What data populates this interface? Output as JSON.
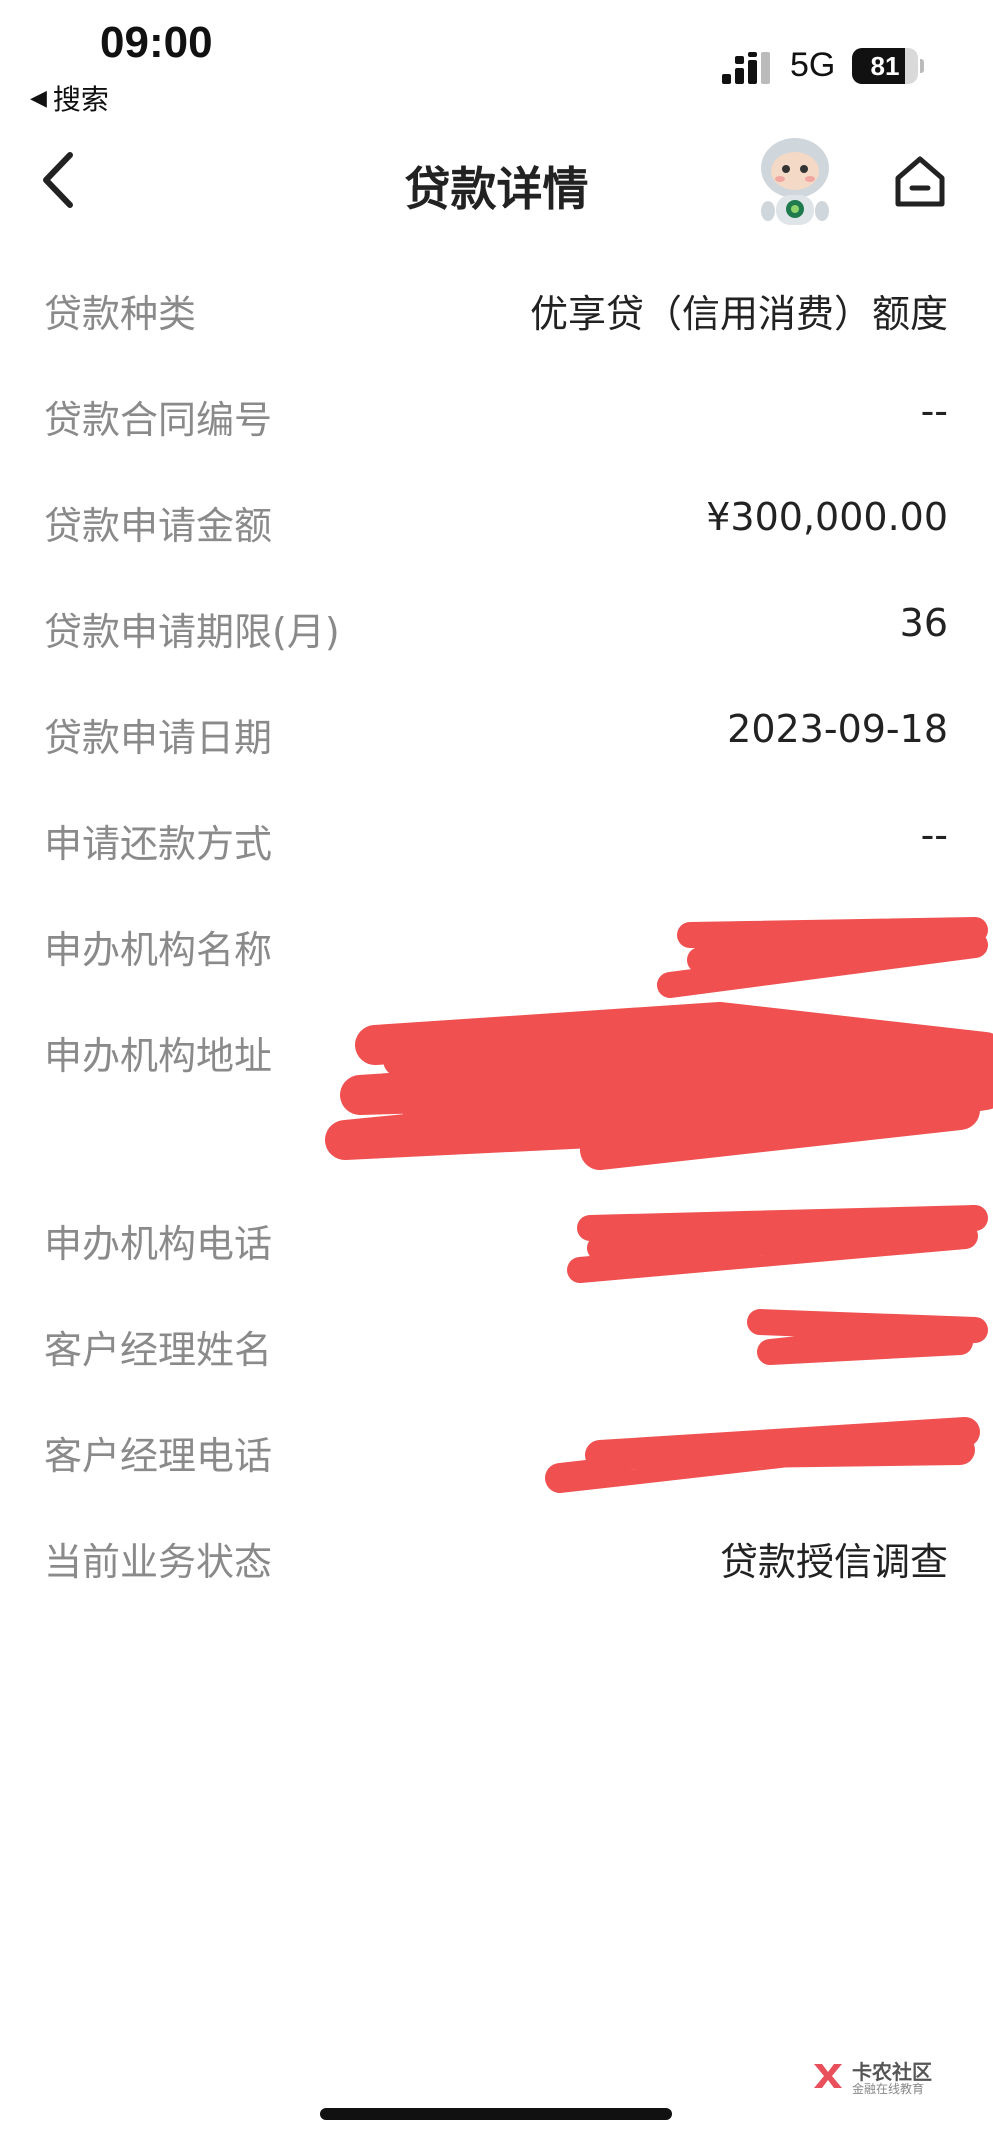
{
  "status_bar": {
    "time": "09:00",
    "back_app": "搜索",
    "network": "5G",
    "battery_level": 81,
    "battery_label": "81"
  },
  "nav": {
    "title": "贷款详情",
    "back_icon": "chevron-left-icon",
    "assistant_icon": "robot-mascot-icon",
    "home_icon": "home-icon"
  },
  "details": [
    {
      "label": "贷款种类",
      "value": "优享贷（信用消费）额度"
    },
    {
      "label": "贷款合同编号",
      "value": "--"
    },
    {
      "label": "贷款申请金额",
      "value": "¥300,000.00"
    },
    {
      "label": "贷款申请期限(月)",
      "value": "36"
    },
    {
      "label": "贷款申请日期",
      "value": "2023-09-18"
    },
    {
      "label": "申请还款方式",
      "value": "--"
    },
    {
      "label": "申办机构名称",
      "value": ""
    },
    {
      "label": "申办机构地址",
      "value": ""
    },
    {
      "label": "申办机构电话",
      "value": ""
    },
    {
      "label": "客户经理姓名",
      "value": ""
    },
    {
      "label": "客户经理电话",
      "value": ""
    },
    {
      "label": "当前业务状态",
      "value": "贷款授信调查"
    }
  ],
  "watermark": {
    "title": "卡农社区",
    "subtitle": "金融在线教育"
  },
  "colors": {
    "redaction": "#f05050",
    "label": "#8a8a8a",
    "value": "#222222"
  }
}
